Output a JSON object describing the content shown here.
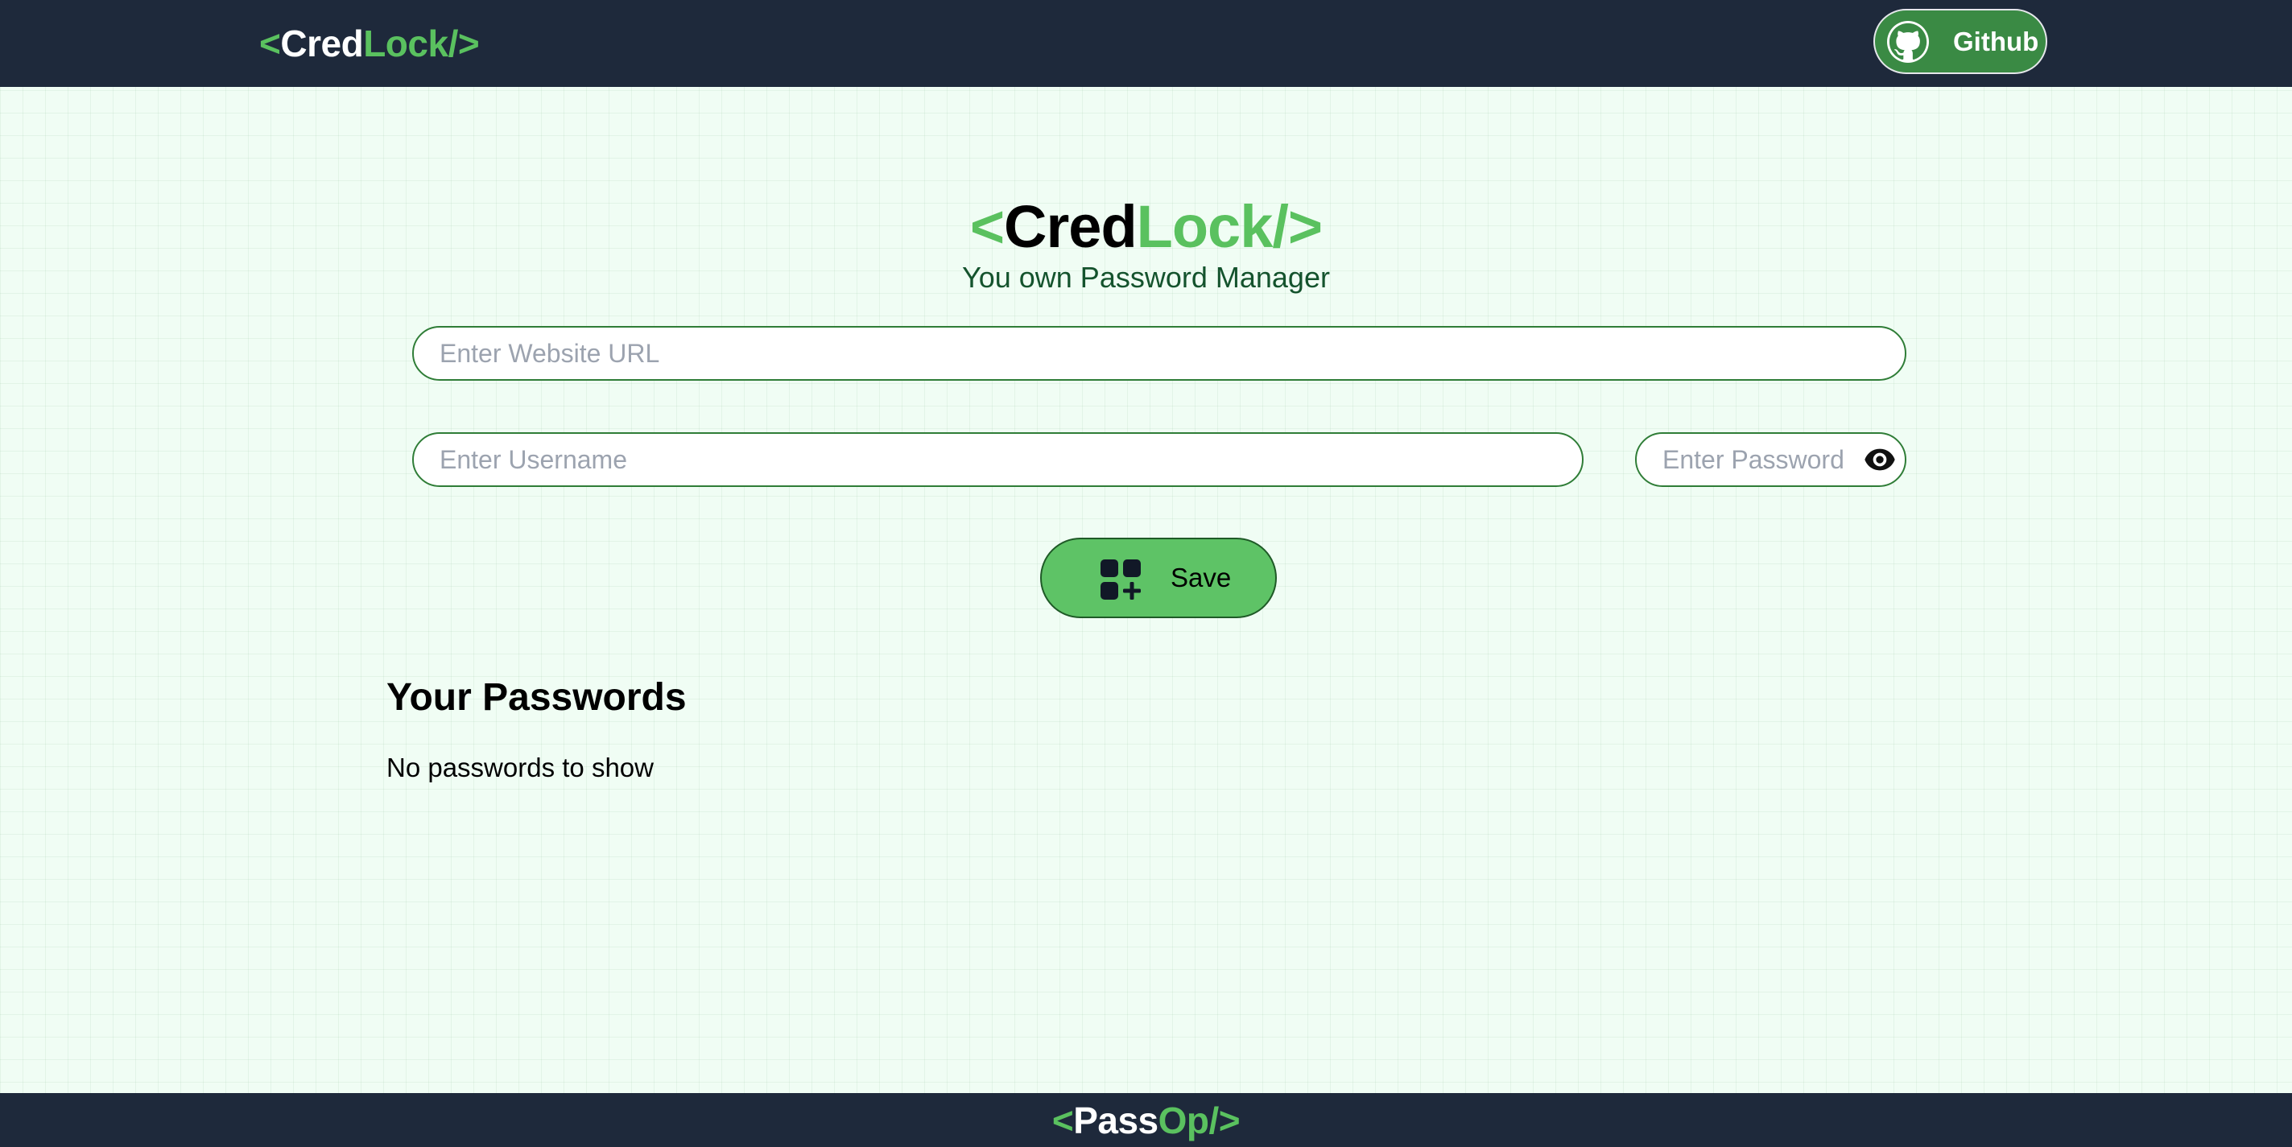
{
  "navbar": {
    "logo": {
      "open": "<",
      "part1": "Cred",
      "part2": "Lock",
      "close": "/>"
    },
    "github_label": "Github"
  },
  "hero": {
    "logo": {
      "open": "<",
      "part1": "Cred",
      "part2": "Lock",
      "close": "/>"
    },
    "tagline": "You own Password Manager"
  },
  "form": {
    "url_placeholder": "Enter Website URL",
    "url_value": "",
    "username_placeholder": "Enter Username",
    "username_value": "",
    "password_placeholder": "Enter Password",
    "password_value": "",
    "save_label": "Save"
  },
  "passwords": {
    "title": "Your Passwords",
    "empty_message": "No passwords to show"
  },
  "footer": {
    "logo": {
      "open": "<",
      "part1": "Pass",
      "part2": "Op",
      "close": "/>"
    }
  },
  "icons": {
    "github": "github-icon",
    "eye": "eye-icon",
    "add": "add-grid-icon"
  },
  "colors": {
    "accent_green": "#5ac15f",
    "navbar_bg": "#1e293b",
    "page_bg": "#f0fdf4",
    "github_btn_bg": "#3a8a44",
    "save_btn_bg": "#5ec366"
  }
}
